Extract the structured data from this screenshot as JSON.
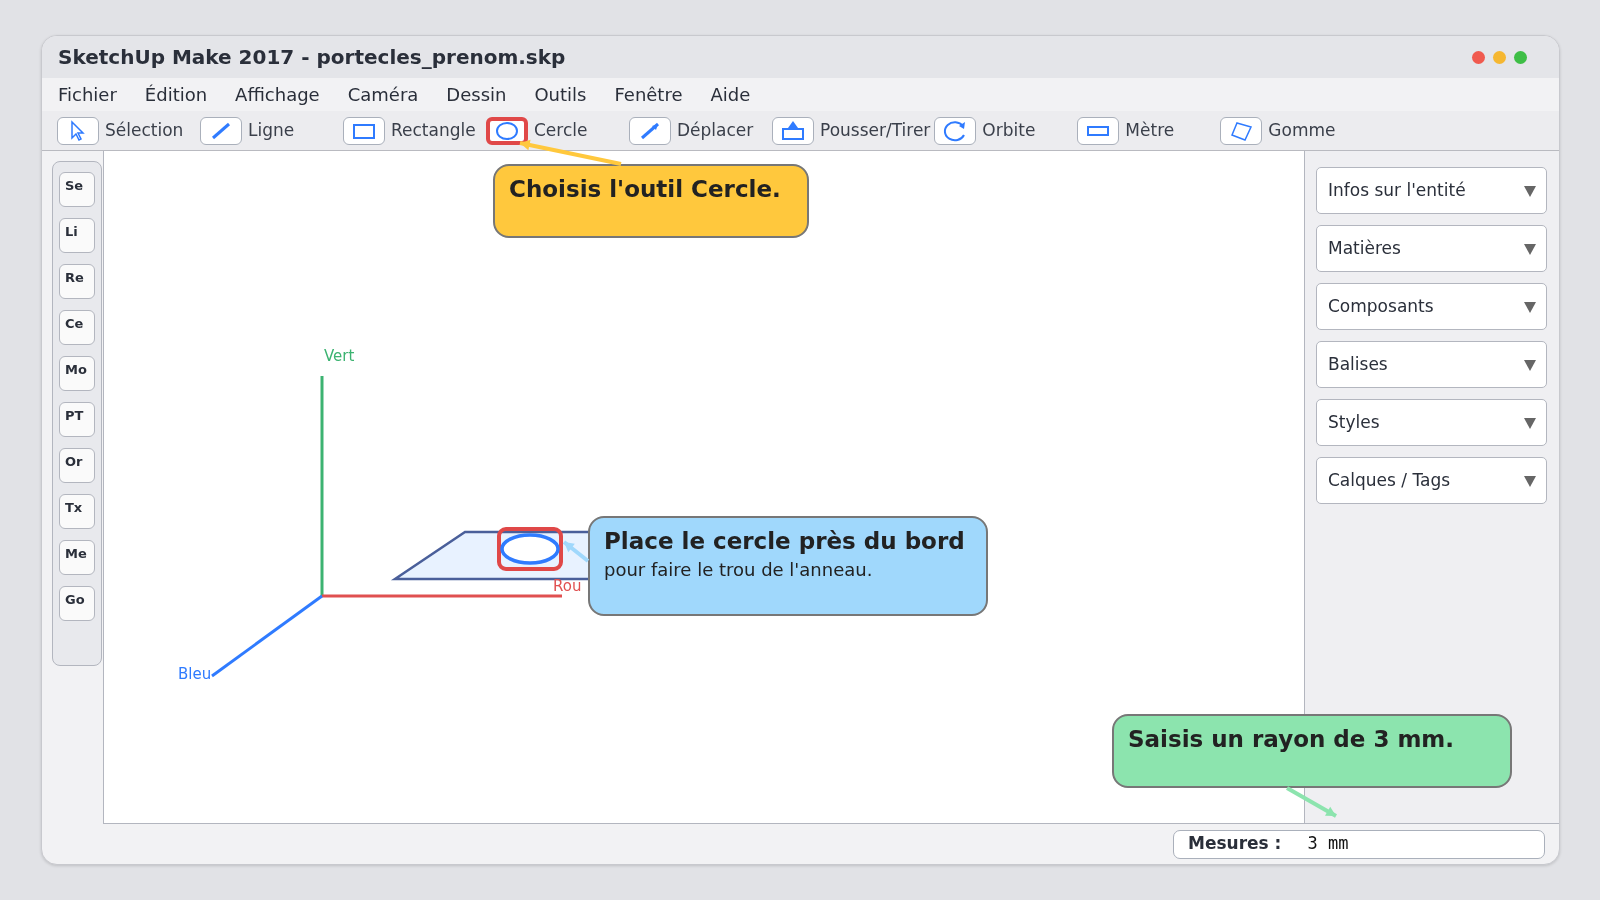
{
  "window": {
    "title": "SketchUp Make 2017 - portecles_prenom.skp"
  },
  "menu": [
    "Fichier",
    "Édition",
    "Affichage",
    "Caméra",
    "Dessin",
    "Outils",
    "Fenêtre",
    "Aide"
  ],
  "toolbar": [
    {
      "label": "Sélection",
      "selected": false
    },
    {
      "label": "Ligne",
      "selected": false
    },
    {
      "label": "Rectangle",
      "selected": false
    },
    {
      "label": "Cercle",
      "selected": true
    },
    {
      "label": "Déplacer",
      "selected": false
    },
    {
      "label": "Pousser/Tirer",
      "selected": false
    },
    {
      "label": "Orbite",
      "selected": false
    },
    {
      "label": "Mètre",
      "selected": false
    },
    {
      "label": "Gomme",
      "selected": false
    }
  ],
  "sidebar": {
    "items": [
      "Se",
      "Li",
      "Re",
      "Ce",
      "Mo",
      "PT",
      "Or",
      "Tx",
      "Me",
      "Go"
    ]
  },
  "viewport": {
    "axes": [
      {
        "label": "Vert",
        "color": "#3cb371"
      },
      {
        "label": "Rou",
        "color": "#e05050"
      },
      {
        "label": "Bleu",
        "color": "#2f7bff"
      }
    ]
  },
  "callouts": [
    {
      "title": "Choisis l'outil Cercle.",
      "color": "#ffc83d"
    },
    {
      "title": "Place le cercle près du bord",
      "text": "pour faire le trou de l'anneau.",
      "color": "#a0d8fc"
    },
    {
      "title": "Saisis un rayon de 3 mm.",
      "color": "#8ce4ae"
    }
  ],
  "panels": [
    "Infos sur l'entité",
    "Matières",
    "Composants",
    "Balises",
    "Styles",
    "Calques / Tags"
  ],
  "status_bar": {
    "label": "Mesures :",
    "value": "3 mm"
  }
}
